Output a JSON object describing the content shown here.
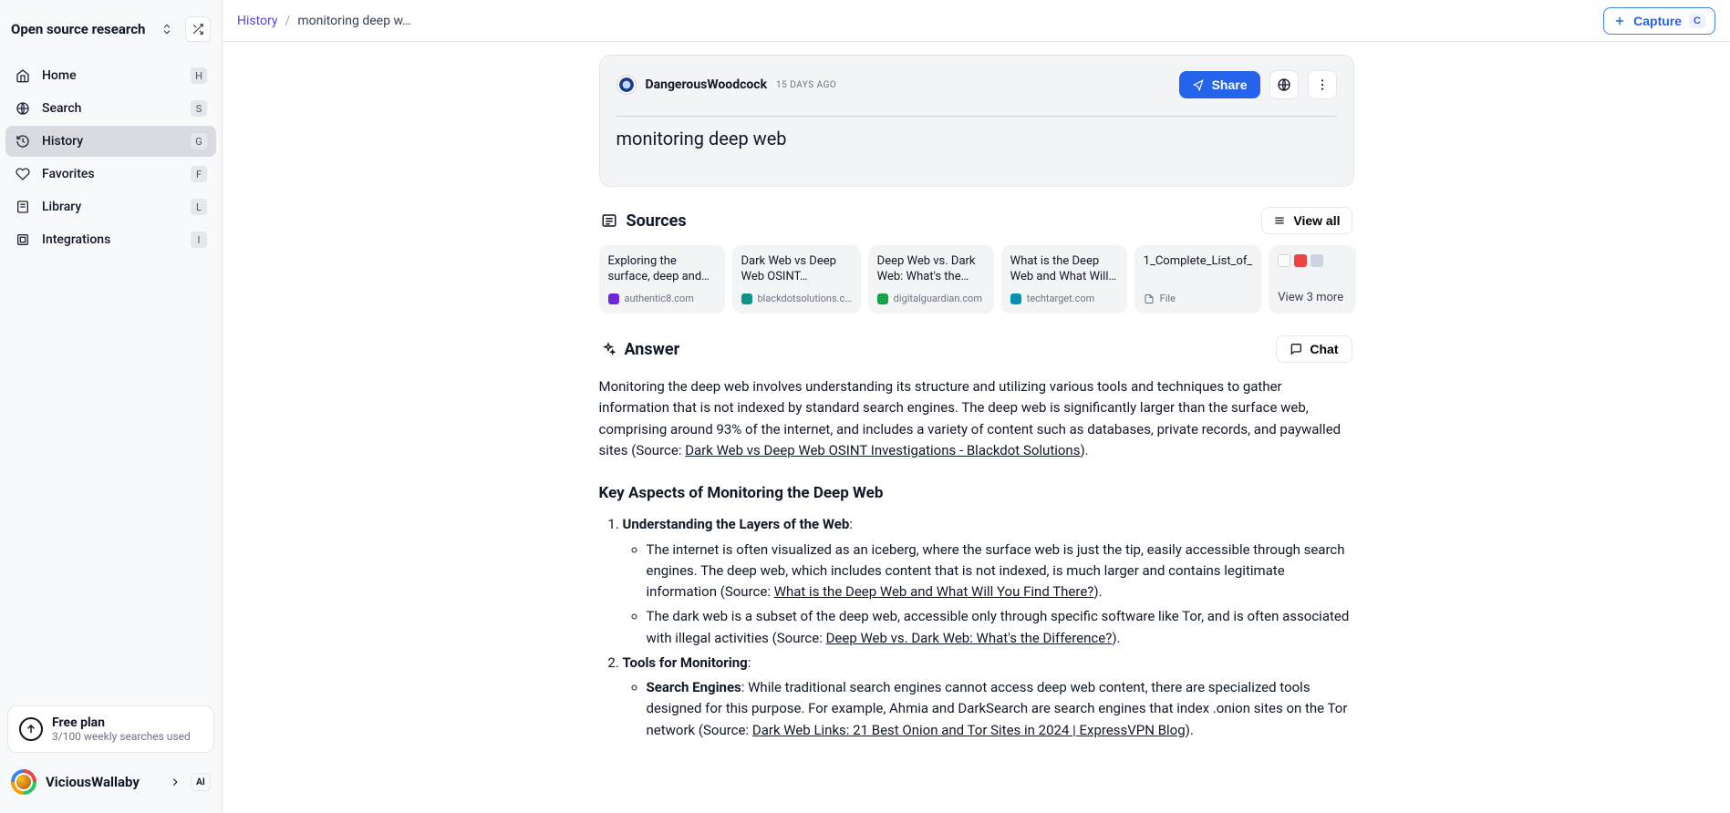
{
  "workspace": {
    "title": "Open source research"
  },
  "sidebar": {
    "items": [
      {
        "label": "Home",
        "shortcut": "H",
        "active": false
      },
      {
        "label": "Search",
        "shortcut": "S",
        "active": false
      },
      {
        "label": "History",
        "shortcut": "G",
        "active": true
      },
      {
        "label": "Favorites",
        "shortcut": "F",
        "active": false
      },
      {
        "label": "Library",
        "shortcut": "L",
        "active": false
      },
      {
        "label": "Integrations",
        "shortcut": "I",
        "active": false
      }
    ],
    "plan": {
      "title": "Free plan",
      "subtitle": "3/100 weekly searches used"
    },
    "user": {
      "name": "ViciousWallaby",
      "ai_badge": "AI"
    }
  },
  "breadcrumb": {
    "root": "History",
    "current": "monitoring deep w…"
  },
  "capture": {
    "label": "Capture",
    "key": "C"
  },
  "query_card": {
    "author": "DangerousWoodcock",
    "time": "15 DAYS AGO",
    "share": "Share",
    "query": "monitoring deep web"
  },
  "sources": {
    "title": "Sources",
    "view_all": "View all",
    "items": [
      {
        "title": "Exploring the surface, deep and…",
        "domain": "authentic8.com",
        "color": "#6d28d9"
      },
      {
        "title": "Dark Web vs Deep Web OSINT…",
        "domain": "blackdotsolutions.c…",
        "color": "#0d9488"
      },
      {
        "title": "Deep Web vs. Dark Web: What's the…",
        "domain": "digitalguardian.com",
        "color": "#16a34a"
      },
      {
        "title": "What is the Deep Web and What Will…",
        "domain": "techtarget.com",
        "color": "#0891b2"
      },
      {
        "title": "1_Complete_List_of_",
        "domain": "File",
        "color": "#64748b"
      }
    ],
    "more": {
      "label": "View 3 more"
    }
  },
  "answer": {
    "title": "Answer",
    "chat": "Chat",
    "intro_pre": "Monitoring the deep web involves understanding its structure and utilizing various tools and techniques to gather information that is not indexed by standard search engines. The deep web is significantly larger than the surface web, comprising around 93% of the internet, and includes a variety of content such as databases, private records, and paywalled sites (Source: ",
    "intro_link": "Dark Web vs Deep Web OSINT Investigations - Blackdot Solutions",
    "intro_post": ").",
    "heading": "Key Aspects of Monitoring the Deep Web",
    "p1_title": "Understanding the Layers of the Web",
    "p1_b1_pre": "The internet is often visualized as an iceberg, where the surface web is just the tip, easily accessible through search engines. The deep web, which includes content that is not indexed, is much larger and contains legitimate information (Source: ",
    "p1_b1_link": "What is the Deep Web and What Will You Find There?",
    "p1_b1_post": ").",
    "p1_b2_pre": "The dark web is a subset of the deep web, accessible only through specific software like Tor, and is often associated with illegal activities (Source: ",
    "p1_b2_link": "Deep Web vs. Dark Web: What's the Difference?",
    "p1_b2_post": ").",
    "p2_title": "Tools for Monitoring",
    "p2_b1_strong": "Search Engines",
    "p2_b1_pre": ": While traditional search engines cannot access deep web content, there are specialized tools designed for this purpose. For example, Ahmia and DarkSearch are search engines that index .onion sites on the Tor network (Source: ",
    "p2_b1_link": "Dark Web Links: 21 Best Onion and Tor Sites in 2024 | ExpressVPN Blog",
    "p2_b1_post": ")."
  }
}
